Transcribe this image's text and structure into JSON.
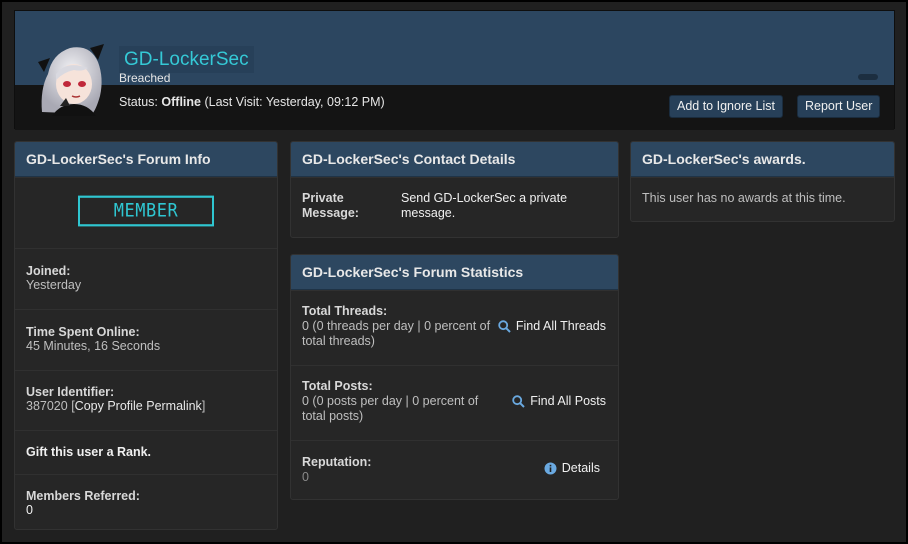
{
  "profile": {
    "username": "GD-LockerSec",
    "user_title": "Breached",
    "status_label": "Status:",
    "status_value": "Offline",
    "last_visit": "(Last Visit: Yesterday, 09:12 PM)",
    "buttons": {
      "ignore": "Add to Ignore List",
      "report": "Report User"
    }
  },
  "forum_info": {
    "title": "GD-LockerSec's Forum Info",
    "rank_badge": "MEMBER",
    "joined": {
      "label": "Joined:",
      "value": "Yesterday"
    },
    "time_online": {
      "label": "Time Spent Online:",
      "value": "45 Minutes, 16 Seconds"
    },
    "user_identifier": {
      "label": "User Identifier:",
      "id": "387020",
      "link": "Copy Profile Permalink"
    },
    "gift_rank": "Gift this user a Rank.",
    "members_referred": {
      "label": "Members Referred:",
      "value": "0"
    }
  },
  "contact": {
    "title": "GD-LockerSec's Contact Details",
    "pm_label_1": "Private",
    "pm_label_2": "Message:",
    "pm_value_1": "Send GD-LockerSec a private",
    "pm_value_2": "message."
  },
  "stats": {
    "title": "GD-LockerSec's Forum Statistics",
    "threads": {
      "label": "Total Threads:",
      "line1": "0 (0 threads per day | 0 percent of",
      "line2": "total threads)",
      "link": "Find All Threads"
    },
    "posts": {
      "label": "Total Posts:",
      "line1": "0 (0 posts per day | 0 percent of",
      "line2": "total posts)",
      "link": "Find All Posts"
    },
    "reputation": {
      "label": "Reputation:",
      "value": "0",
      "link": "Details"
    }
  },
  "awards": {
    "title": "GD-LockerSec's awards.",
    "empty_text": "This user has no awards at this time."
  },
  "colors": {
    "header_blue": "#2d4760",
    "username_cyan": "#35c9d6",
    "rank_cyan": "#2fc6d1",
    "background": "#202020"
  },
  "icons": {
    "avatar": "anime-avatar",
    "search": "search-icon",
    "info": "info-icon"
  }
}
